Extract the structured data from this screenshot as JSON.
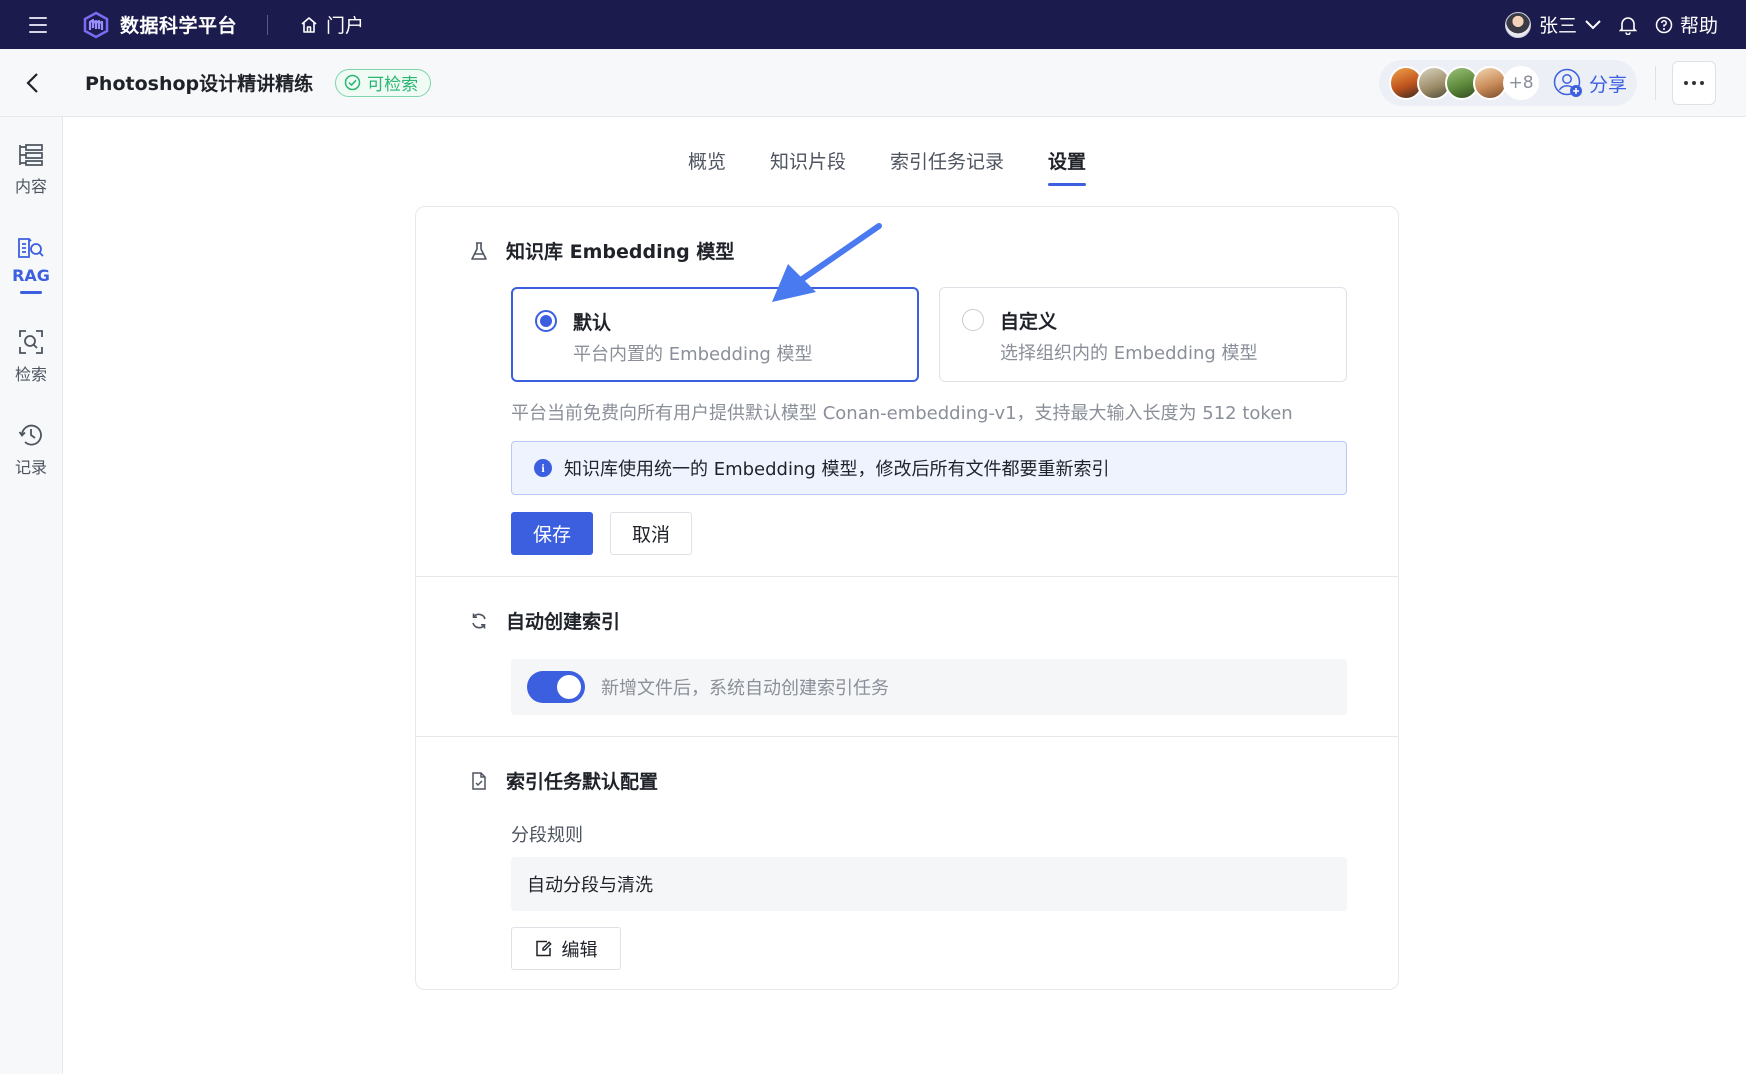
{
  "topbar": {
    "brand": "数据科学平台",
    "portal": "门户",
    "user_name": "张三",
    "help": "帮助"
  },
  "subheader": {
    "title": "Photoshop设计精讲精练",
    "status": "可检索",
    "collaborators_extra": "+8",
    "share": "分享"
  },
  "sidebar": {
    "items": [
      {
        "label": "内容",
        "icon": "content-list-icon"
      },
      {
        "label": "RAG",
        "icon": "rag-book-icon"
      },
      {
        "label": "检索",
        "icon": "search-scan-icon"
      },
      {
        "label": "记录",
        "icon": "history-icon"
      }
    ],
    "active": "RAG"
  },
  "tabs": [
    "概览",
    "知识片段",
    "索引任务记录",
    "设置"
  ],
  "active_tab": "设置",
  "embedding": {
    "title": "知识库 Embedding 模型",
    "options": [
      {
        "title": "默认",
        "desc": "平台内置的 Embedding 模型",
        "selected": true
      },
      {
        "title": "自定义",
        "desc": "选择组织内的 Embedding 模型",
        "selected": false
      }
    ],
    "hint": "平台当前免费向所有用户提供默认模型 Conan-embedding-v1，支持最大输入长度为 512 token",
    "info": "知识库使用统一的 Embedding 模型，修改后所有文件都要重新索引",
    "save": "保存",
    "cancel": "取消"
  },
  "auto_index": {
    "title": "自动创建索引",
    "toggle_on": true,
    "toggle_label": "新增文件后，系统自动创建索引任务"
  },
  "index_config": {
    "title": "索引任务默认配置",
    "rule_label": "分段规则",
    "rule_value": "自动分段与清洗",
    "edit": "编辑"
  },
  "colors": {
    "topbar_bg": "#1c1b4d",
    "accent": "#3c5fe0",
    "success": "#2bb673",
    "annotation_arrow": "#4a7af0"
  }
}
